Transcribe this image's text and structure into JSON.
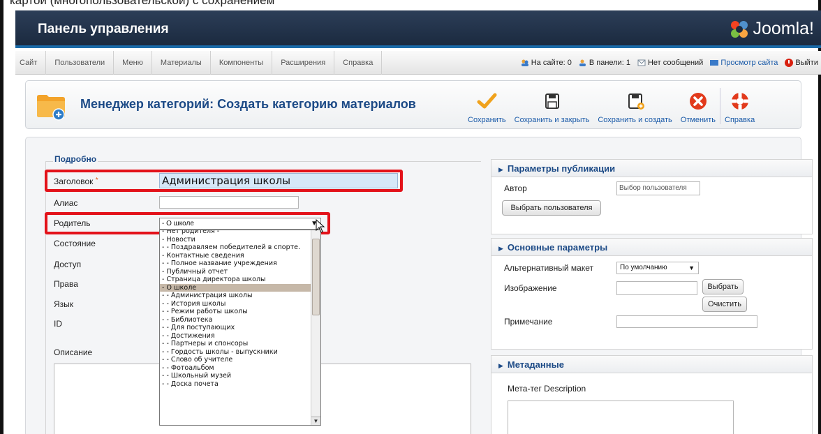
{
  "header": {
    "title": "Панель управления",
    "brand": "Joomla!"
  },
  "top_cut_text": "картой (многопользовательской) с сохранением",
  "menu": {
    "items": [
      "Сайт",
      "Пользователи",
      "Меню",
      "Материалы",
      "Компоненты",
      "Расширения",
      "Справка"
    ]
  },
  "status": {
    "online": "На сайте: 0",
    "in_panel": "В панели: 1",
    "messages": "Нет сообщений",
    "view_site": "Просмотр сайта",
    "logout": "Выйти"
  },
  "toolbar": {
    "heading": "Менеджер категорий: Создать категорию материалов",
    "save": "Сохранить",
    "save_close": "Сохранить и закрыть",
    "save_new": "Сохранить и создать",
    "cancel": "Отменить",
    "help": "Справка"
  },
  "form": {
    "legend": "Подробно",
    "title_label": "Заголовок",
    "required_mark": "*",
    "title_value": "Администрация школы",
    "alias_label": "Алиас",
    "parent_label": "Родитель",
    "parent_value": "- О школе",
    "state_label": "Состояние",
    "access_label": "Доступ",
    "rights_label": "Права",
    "language_label": "Язык",
    "id_label": "ID",
    "description_label": "Описание"
  },
  "parent_options": [
    "- Нет родителя -",
    "- Новости",
    "- - Поздравляем победителей в спорте.",
    "- Контактные сведения",
    "- - Полное название учреждения",
    "- Публичный отчет",
    "- Страница директора школы",
    "- О школе",
    "- - Администрация школы",
    "- - История школы",
    "- - Режим работы школы",
    "- - Библиотека",
    "- - Для поступающих",
    "- - Достижения",
    "- - Партнеры и спонсоры",
    "- - Гордость школы - выпускники",
    "- - Слово об учителе",
    "- - Фотоальбом",
    "- - Школьный музей",
    "- - Доска почета"
  ],
  "parent_selected_index": 7,
  "publishing": {
    "title": "Параметры публикации",
    "author_label": "Автор",
    "author_placeholder": "Выбор пользователя",
    "select_user_button": "Выбрать пользователя"
  },
  "basic": {
    "title": "Основные параметры",
    "layout_label": "Альтернативный макет",
    "layout_value": "По умолчанию",
    "image_label": "Изображение",
    "select_button": "Выбрать",
    "clear_button": "Очистить",
    "note_label": "Примечание"
  },
  "metadata": {
    "title": "Метаданные",
    "description_label": "Мета-тег Description"
  },
  "colors": {
    "header": "#1b2a3f",
    "accent": "#1a6aa8",
    "highlight": "#e3121a",
    "heading": "#1c4a86"
  }
}
